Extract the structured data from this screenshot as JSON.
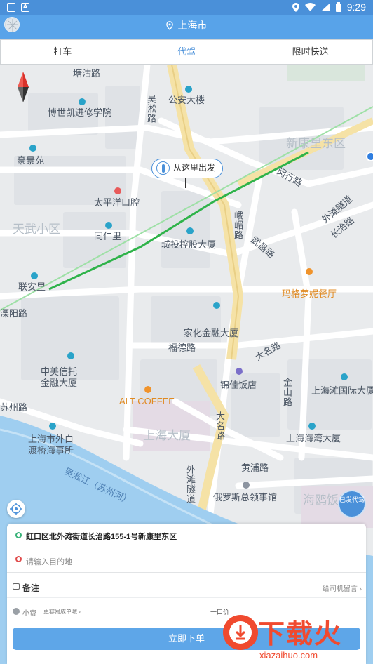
{
  "status_bar": {
    "time": "9:29"
  },
  "header": {
    "city": "上海市"
  },
  "tabs": [
    {
      "label": "打车"
    },
    {
      "label": "代驾",
      "active": true
    },
    {
      "label": "限时快送"
    }
  ],
  "map": {
    "start_label": "从这里出发",
    "badge": "已发代驾",
    "roads": [
      "塘沽路",
      "吴淞路",
      "闵行路",
      "外滩隧道",
      "长治路",
      "峨嵋路",
      "武昌路",
      "福德路",
      "大名路",
      "金山路",
      "苏州路",
      "大名路",
      "外滩隧道",
      "黄浦路",
      "吴淞江（苏州河）",
      "溧阳路"
    ],
    "places": [
      "公安大楼",
      "博世凯进修学院",
      "新康里东区",
      "豪景苑",
      "太平洋口腔",
      "天武小区",
      "同仁里",
      "城投控股大厦",
      "联安里",
      "玛格萝妮餐厅",
      "家化金融大厦",
      "中美信托金融大厦",
      "锦佳饭店",
      "上海滩国际大厦",
      "ALT COFFEE",
      "上海大厦",
      "上海海湾大厦",
      "上海市外白渡桥海事所",
      "俄罗斯总领事馆",
      "海鸥饭店"
    ]
  },
  "panel": {
    "origin": "虹口区北外滩街道长治路155-1号新康里东区",
    "destination_placeholder": "请输入目的地",
    "note_label": "备注",
    "note_hint": "给司机留言",
    "tip_label": "小费",
    "tip_hint": "更容易成单哦",
    "price": "一口价",
    "submit": "立即下单"
  },
  "watermark": {
    "text": "下载火",
    "url": "xiazaihuo.com"
  },
  "colors": {
    "primary": "#4a90d9",
    "route": "#2fb34a",
    "watermark": "#f04a2f"
  }
}
